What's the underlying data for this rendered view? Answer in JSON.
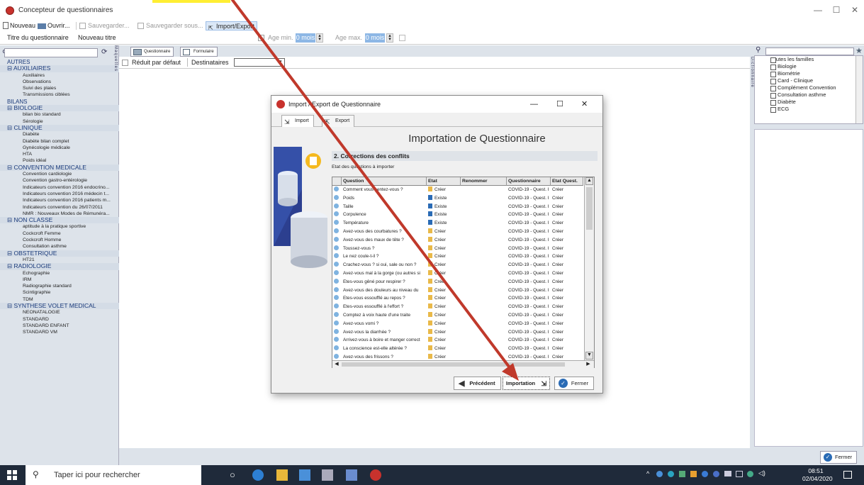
{
  "window": {
    "title": "Concepteur de questionnaires",
    "minimize": "—",
    "maximize": "☐",
    "close": "✕"
  },
  "toolbar": {
    "nouveau": "Nouveau",
    "ouvrir": "Ouvrir...",
    "sauvegarder": "Sauvegarder...",
    "sauvegarder_sous": "Sauvegarder sous...",
    "import_export": "Import/Export"
  },
  "header": {
    "title_label": "Titre du questionnaire",
    "title_value": "Nouveau titre",
    "age_min_label": "Age min.",
    "age_min_value": "0 mois",
    "age_max_label": "Age max.",
    "age_max_value": "0 mois"
  },
  "left": {
    "search_placeholder": "",
    "vertical_label": "Maquettes",
    "tree": [
      {
        "t": "AUTRES",
        "k": "root"
      },
      {
        "t": "⊟ AUXILIAIRES",
        "k": "cat"
      },
      {
        "t": "Auxiliaires",
        "k": "sub"
      },
      {
        "t": "Observations",
        "k": "sub"
      },
      {
        "t": "Suivi des plaies",
        "k": "sub"
      },
      {
        "t": "Transmissions ciblées",
        "k": "sub"
      },
      {
        "t": "BILANS",
        "k": "root"
      },
      {
        "t": "⊟ BIOLOGIE",
        "k": "cat"
      },
      {
        "t": "bilan bio standard",
        "k": "sub"
      },
      {
        "t": "Sérologie",
        "k": "sub"
      },
      {
        "t": "⊟ CLINIQUE",
        "k": "cat"
      },
      {
        "t": "Diabète",
        "k": "sub"
      },
      {
        "t": "Diabète bilan complet",
        "k": "sub"
      },
      {
        "t": "Gynécologie médicale",
        "k": "sub"
      },
      {
        "t": "HTA",
        "k": "sub"
      },
      {
        "t": "Poids idéal",
        "k": "sub"
      },
      {
        "t": "⊟ CONVENTION MEDICALE",
        "k": "cat"
      },
      {
        "t": "Convention cardiologie",
        "k": "sub"
      },
      {
        "t": "Convention gastro-entérologie",
        "k": "sub"
      },
      {
        "t": "Indicateurs convention 2016 endocrino...",
        "k": "sub"
      },
      {
        "t": "Indicateurs convention 2016 médecin t...",
        "k": "sub"
      },
      {
        "t": "Indicateurs convention 2016 patients m...",
        "k": "sub"
      },
      {
        "t": "Indicateurs convention du 26/07/2011",
        "k": "sub"
      },
      {
        "t": "NMR : Nouveaux Modes de Rémunéra...",
        "k": "sub"
      },
      {
        "t": "⊟ NON CLASSE",
        "k": "cat"
      },
      {
        "t": "aptitude à la pratique sportive",
        "k": "sub"
      },
      {
        "t": "Cockcroft Femme",
        "k": "sub"
      },
      {
        "t": "Cockcroft Homme",
        "k": "sub"
      },
      {
        "t": "Consultation asthme",
        "k": "sub"
      },
      {
        "t": "⊟ OBSTETRIQUE",
        "k": "cat"
      },
      {
        "t": "HT21",
        "k": "sub"
      },
      {
        "t": "⊟ RADIOLOGIE",
        "k": "cat"
      },
      {
        "t": "Echographie",
        "k": "sub"
      },
      {
        "t": "IRM",
        "k": "sub"
      },
      {
        "t": "Radiographie standard",
        "k": "sub"
      },
      {
        "t": "Scintigraphie",
        "k": "sub"
      },
      {
        "t": "TDM",
        "k": "sub"
      },
      {
        "t": "⊟ SYNTHESE VOLET MEDICAL",
        "k": "cat"
      },
      {
        "t": "NEONATALOGIE",
        "k": "sub"
      },
      {
        "t": "STANDARD",
        "k": "sub"
      },
      {
        "t": "STANDARD ENFANT",
        "k": "sub"
      },
      {
        "t": "STANDARD VM",
        "k": "sub"
      }
    ]
  },
  "center": {
    "tab_questionnaire": "Questionnaire",
    "tab_formulaire": "Formulaire",
    "reduit_label": "Réduit par défaut",
    "destinataires_label": "Destinataires"
  },
  "right": {
    "vertical_label": "Dictionnaire",
    "root": "Toutes les familles",
    "items": [
      "Biologie",
      "Biométrie",
      "Card - Clinique",
      "Complément Convention",
      "Consultation asthme",
      "Diabète",
      "ECG"
    ],
    "fermer": "Fermer"
  },
  "dialog": {
    "title": "Import / Export de Questionnaire",
    "tab_import": "Import",
    "tab_export": "Export",
    "heading": "Importation de Questionnaire",
    "section": "2. Corrections des conflits",
    "etat_label": "Etat des questions à importer",
    "columns": [
      "Question",
      "Etat",
      "Renommer",
      "Questionnaire",
      "Etat Quest."
    ],
    "rows": [
      [
        "Comment vous sentez-vous ?",
        "Créer",
        "",
        "COVID-19 - Quest. I",
        "Créer"
      ],
      [
        "Poids",
        "Existe",
        "",
        "COVID-19 - Quest. I",
        "Créer"
      ],
      [
        "Taille",
        "Existe",
        "",
        "COVID-19 - Quest. I",
        "Créer"
      ],
      [
        "Corpulence",
        "Existe",
        "",
        "COVID-19 - Quest. I",
        "Créer"
      ],
      [
        "Température",
        "Existe",
        "",
        "COVID-19 - Quest. I",
        "Créer"
      ],
      [
        "Avez-vous des courbatures ?",
        "Créer",
        "",
        "COVID-19 - Quest. I",
        "Créer"
      ],
      [
        "Avez-vous des maux de tête ?",
        "Créer",
        "",
        "COVID-19 - Quest. I",
        "Créer"
      ],
      [
        "Toussez-vous ?",
        "Créer",
        "",
        "COVID-19 - Quest. I",
        "Créer"
      ],
      [
        "Le nez coule-t-il ?",
        "Créer",
        "",
        "COVID-19 - Quest. I",
        "Créer"
      ],
      [
        "Crachez-vous ? si oui, sale ou non ?",
        "Créer",
        "",
        "COVID-19 - Quest. I",
        "Créer"
      ],
      [
        "Avez-vous mal à la gorge (ou autres si",
        "Créer",
        "",
        "COVID-19 - Quest. I",
        "Créer"
      ],
      [
        "Etes-vous gêné pour respirer ?",
        "Créer",
        "",
        "COVID-19 - Quest. I",
        "Créer"
      ],
      [
        "Avez-vous des douleurs au niveau du",
        "Créer",
        "",
        "COVID-19 - Quest. I",
        "Créer"
      ],
      [
        "Etes-vous essoufflé au repos ?",
        "Créer",
        "",
        "COVID-19 - Quest. I",
        "Créer"
      ],
      [
        "Etes-vous essoufflé à l'effort ?",
        "Créer",
        "",
        "COVID-19 - Quest. I",
        "Créer"
      ],
      [
        "Comptez à voix haute d'une traite",
        "Créer",
        "",
        "COVID-19 - Quest. I",
        "Créer"
      ],
      [
        "Avez-vous vomi ?",
        "Créer",
        "",
        "COVID-19 - Quest. I",
        "Créer"
      ],
      [
        "Avez-vous la diarrhée ?",
        "Créer",
        "",
        "COVID-19 - Quest. I",
        "Créer"
      ],
      [
        "Arrivez-vous à boire et manger correct",
        "Créer",
        "",
        "COVID-19 - Quest. I",
        "Créer"
      ],
      [
        "La conscience est-elle altérée ?",
        "Créer",
        "",
        "COVID-19 - Quest. I",
        "Créer"
      ],
      [
        "Avez-vous des frissons ?",
        "Créer",
        "",
        "COVID-19 - Quest. I",
        "Créer"
      ]
    ],
    "btn_precedent": "Précédent",
    "btn_importation": "Importation",
    "btn_fermer": "Fermer"
  },
  "taskbar": {
    "search_placeholder": "Taper ici pour rechercher",
    "time": "08:51",
    "date": "02/04/2020"
  },
  "colors": {
    "panel": "#dde3ea",
    "accent": "#2a6bb5",
    "arrow": "#c0392b",
    "taskbar": "#1f2a3a"
  }
}
